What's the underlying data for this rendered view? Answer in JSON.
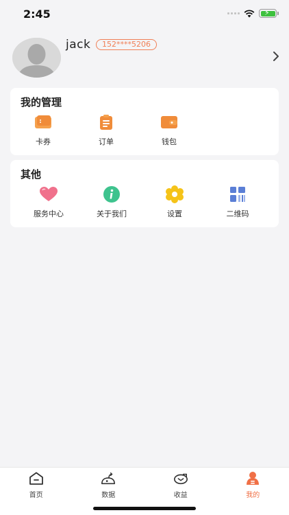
{
  "status": {
    "time": "2:45"
  },
  "profile": {
    "username": "jack",
    "phone": "152****5206"
  },
  "management": {
    "title": "我的管理",
    "items": [
      {
        "label": "卡券",
        "icon": "coupon-icon"
      },
      {
        "label": "订单",
        "icon": "order-icon"
      },
      {
        "label": "钱包",
        "icon": "wallet-icon"
      }
    ]
  },
  "other": {
    "title": "其他",
    "items": [
      {
        "label": "服务中心",
        "icon": "heart-icon"
      },
      {
        "label": "关于我们",
        "icon": "info-icon"
      },
      {
        "label": "设置",
        "icon": "flower-gear-icon"
      },
      {
        "label": "二维码",
        "icon": "qrcode-icon"
      }
    ]
  },
  "tabs": [
    {
      "label": "首页",
      "icon": "home-icon"
    },
    {
      "label": "数据",
      "icon": "data-icon"
    },
    {
      "label": "收益",
      "icon": "income-icon"
    },
    {
      "label": "我的",
      "icon": "profile-icon",
      "active": true
    }
  ],
  "colors": {
    "accent": "#f07046",
    "background": "#f4f4f6",
    "card": "#ffffff"
  }
}
